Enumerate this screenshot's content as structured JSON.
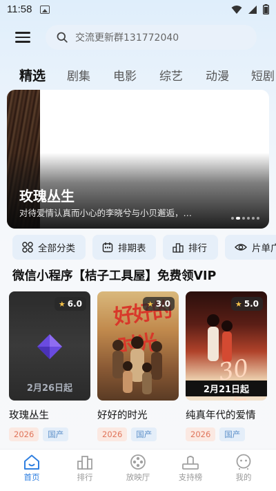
{
  "status_bar": {
    "time": "11:58"
  },
  "search": {
    "text": "交流更新群131772040"
  },
  "tabs": [
    {
      "label": "精选",
      "active": true
    },
    {
      "label": "剧集"
    },
    {
      "label": "电影"
    },
    {
      "label": "综艺"
    },
    {
      "label": "动漫"
    },
    {
      "label": "短剧"
    }
  ],
  "banner": {
    "title": "玫瑰丛生",
    "description": "对待爱情认真而小心的李晓兮与小贝邂逅，…"
  },
  "quick_actions": [
    {
      "label": "全部分类",
      "icon": "grid-icon"
    },
    {
      "label": "排期表",
      "icon": "calendar-icon"
    },
    {
      "label": "排行",
      "icon": "ranking-icon"
    },
    {
      "label": "片单广",
      "icon": "eye-icon"
    }
  ],
  "section": {
    "title": "微信小程序【桔子工具屋】免费领VIP"
  },
  "cards": [
    {
      "title": "玫瑰丛生",
      "rating": "6.0",
      "year": "2026",
      "region": "国产",
      "poster_date": "2月26日起"
    },
    {
      "title": "好好的时光",
      "rating": "3.0",
      "year": "2026",
      "region": "国产",
      "poster_title": "好好的时光"
    },
    {
      "title": "纯真年代的爱情",
      "rating": "5.0",
      "year": "2026",
      "region": "国产",
      "poster_big": "30万",
      "poster_date": "2月21日起"
    }
  ],
  "bottom_nav": [
    {
      "label": "首页",
      "icon": "home-icon",
      "active": true
    },
    {
      "label": "排行",
      "icon": "ranking-icon"
    },
    {
      "label": "放映厅",
      "icon": "film-reel-icon"
    },
    {
      "label": "支持榜",
      "icon": "podium-icon"
    },
    {
      "label": "我的",
      "icon": "user-icon"
    }
  ],
  "colors": {
    "accent": "#2f7fe0",
    "year_tag": "#e0745a",
    "region_tag": "#5b8fc9",
    "star": "#f6c34a"
  }
}
